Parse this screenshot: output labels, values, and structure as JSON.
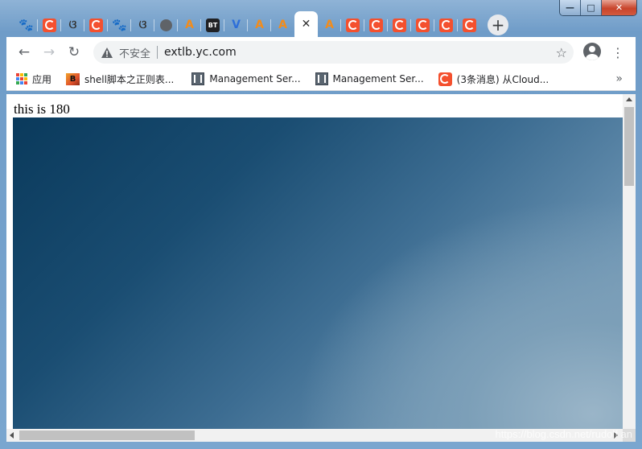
{
  "browser": {
    "tabs": [
      {
        "icon": "paw-icon"
      },
      {
        "icon": "c-icon"
      },
      {
        "icon": "g-icon"
      },
      {
        "icon": "c-icon"
      },
      {
        "icon": "paw-icon"
      },
      {
        "icon": "g-icon"
      },
      {
        "icon": "globe-icon"
      },
      {
        "icon": "a-icon"
      },
      {
        "icon": "bt-icon",
        "text": "BT"
      },
      {
        "icon": "v-icon"
      },
      {
        "icon": "a-icon"
      },
      {
        "icon": "a-icon"
      },
      {
        "icon": "close-icon",
        "active": true
      },
      {
        "icon": "a-icon"
      },
      {
        "icon": "c-icon"
      },
      {
        "icon": "c-icon"
      },
      {
        "icon": "c-icon"
      },
      {
        "icon": "c-icon"
      },
      {
        "icon": "c-icon"
      },
      {
        "icon": "c-icon"
      }
    ],
    "window_controls": {
      "minimize": "—",
      "maximize": "□",
      "close": "✕"
    },
    "toolbar": {
      "back": "←",
      "forward": "→",
      "reload": "↻",
      "security_label": "不安全",
      "url": "extlb.yc.com",
      "star": "☆",
      "menu": "⋮"
    },
    "bookmarks": [
      {
        "label": "应用",
        "icon": "apps-icon"
      },
      {
        "label": "shell脚本之正则表...",
        "icon": "jb-icon"
      },
      {
        "label": "Management Ser...",
        "icon": "ms-icon"
      },
      {
        "label": "Management Ser...",
        "icon": "ms-icon"
      },
      {
        "label": "(3条消息) 从Cloud...",
        "icon": "c-icon"
      }
    ],
    "bookmarks_more": "»"
  },
  "page": {
    "text": "this is 180"
  },
  "watermark": "https://blog.csdn.net/rudolf an",
  "colors": {
    "accent_c": "#f4502e",
    "frame": "#7aa6cf"
  }
}
